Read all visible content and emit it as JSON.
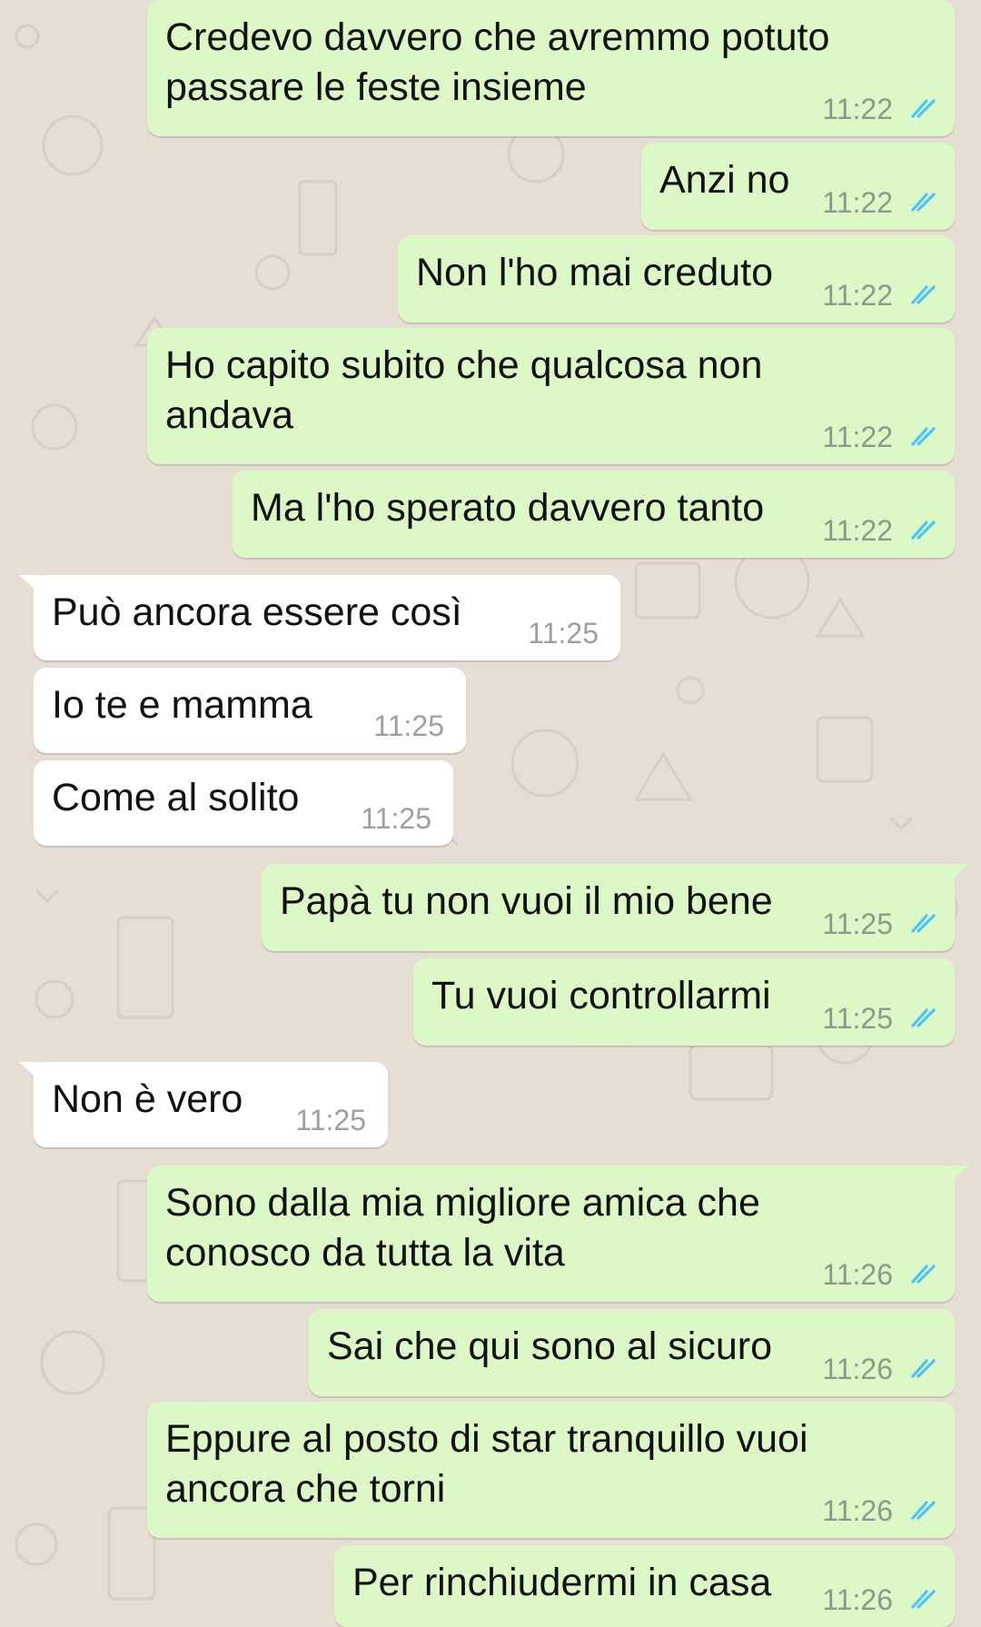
{
  "messages": [
    {
      "dir": "out",
      "text": "Credevo davvero che avremmo potuto\npassare le feste insieme",
      "time": "11:22",
      "status": "read-double-check-icon"
    },
    {
      "dir": "out",
      "text": "Anzi no",
      "time": "11:22",
      "status": "read-double-check-icon"
    },
    {
      "dir": "out",
      "text": "Non l'ho mai creduto",
      "time": "11:22",
      "status": "read-double-check-icon"
    },
    {
      "dir": "out",
      "text": "Ho capito subito che qualcosa non\nandava",
      "time": "11:22",
      "status": "read-double-check-icon"
    },
    {
      "dir": "out",
      "text": "Ma l'ho sperato davvero tanto",
      "time": "11:22",
      "status": "read-double-check-icon"
    },
    {
      "dir": "in",
      "text": "Può ancora essere così",
      "time": "11:25"
    },
    {
      "dir": "in",
      "text": "Io te e mamma",
      "time": "11:25"
    },
    {
      "dir": "in",
      "text": "Come al solito",
      "time": "11:25"
    },
    {
      "dir": "out",
      "text": "Papà tu non vuoi il mio bene",
      "time": "11:25",
      "status": "read-double-check-icon"
    },
    {
      "dir": "out",
      "text": "Tu vuoi controllarmi",
      "time": "11:25",
      "status": "read-double-check-icon"
    },
    {
      "dir": "in",
      "text": "Non è vero",
      "time": "11:25"
    },
    {
      "dir": "out",
      "text": "Sono dalla mia migliore amica che\nconosco da tutta la vita",
      "time": "11:26",
      "status": "read-double-check-icon"
    },
    {
      "dir": "out",
      "text": "Sai che qui sono al sicuro",
      "time": "11:26",
      "status": "read-double-check-icon"
    },
    {
      "dir": "out",
      "text": "Eppure al posto di star tranquillo vuoi\nancora che torni",
      "time": "11:26",
      "status": "read-double-check-icon"
    },
    {
      "dir": "out",
      "text": "Per rinchiudermi in casa",
      "time": "11:26",
      "status": "read-double-check-icon"
    }
  ],
  "colors": {
    "outgoing_bubble": "#dcf8c6",
    "incoming_bubble": "#ffffff",
    "chat_background": "#e6ddd4",
    "read_check": "#4fc3f7"
  }
}
